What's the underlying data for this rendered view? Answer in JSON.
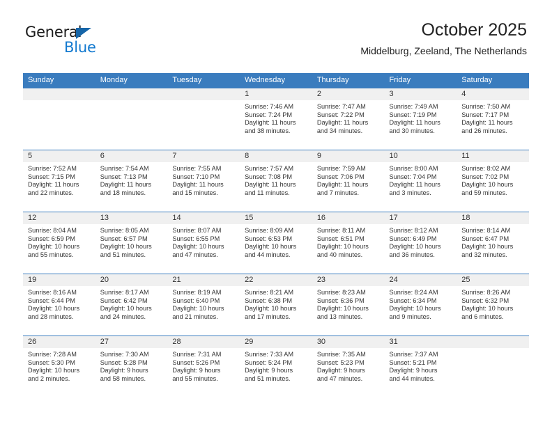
{
  "brand": {
    "name_top": "General",
    "name_bottom": "Blue",
    "triangle_color": "#1565a8",
    "blue_text_color": "#1279cf"
  },
  "header": {
    "title": "October 2025",
    "subtitle": "Middelburg, Zeeland, The Netherlands",
    "accent_color": "#3a7cbe",
    "daynum_band_color": "#f0f0f0"
  },
  "weekdays": [
    "Sunday",
    "Monday",
    "Tuesday",
    "Wednesday",
    "Thursday",
    "Friday",
    "Saturday"
  ],
  "labels": {
    "sunrise_prefix": "Sunrise:",
    "sunset_prefix": "Sunset:",
    "daylight_prefix": "Daylight:"
  },
  "weeks": [
    [
      {
        "day": "",
        "empty": true
      },
      {
        "day": "",
        "empty": true
      },
      {
        "day": "",
        "empty": true
      },
      {
        "day": "1",
        "sunrise": "Sunrise: 7:46 AM",
        "sunset": "Sunset: 7:24 PM",
        "daylight_1": "Daylight: 11 hours",
        "daylight_2": "and 38 minutes."
      },
      {
        "day": "2",
        "sunrise": "Sunrise: 7:47 AM",
        "sunset": "Sunset: 7:22 PM",
        "daylight_1": "Daylight: 11 hours",
        "daylight_2": "and 34 minutes."
      },
      {
        "day": "3",
        "sunrise": "Sunrise: 7:49 AM",
        "sunset": "Sunset: 7:19 PM",
        "daylight_1": "Daylight: 11 hours",
        "daylight_2": "and 30 minutes."
      },
      {
        "day": "4",
        "sunrise": "Sunrise: 7:50 AM",
        "sunset": "Sunset: 7:17 PM",
        "daylight_1": "Daylight: 11 hours",
        "daylight_2": "and 26 minutes."
      }
    ],
    [
      {
        "day": "5",
        "sunrise": "Sunrise: 7:52 AM",
        "sunset": "Sunset: 7:15 PM",
        "daylight_1": "Daylight: 11 hours",
        "daylight_2": "and 22 minutes."
      },
      {
        "day": "6",
        "sunrise": "Sunrise: 7:54 AM",
        "sunset": "Sunset: 7:13 PM",
        "daylight_1": "Daylight: 11 hours",
        "daylight_2": "and 18 minutes."
      },
      {
        "day": "7",
        "sunrise": "Sunrise: 7:55 AM",
        "sunset": "Sunset: 7:10 PM",
        "daylight_1": "Daylight: 11 hours",
        "daylight_2": "and 15 minutes."
      },
      {
        "day": "8",
        "sunrise": "Sunrise: 7:57 AM",
        "sunset": "Sunset: 7:08 PM",
        "daylight_1": "Daylight: 11 hours",
        "daylight_2": "and 11 minutes."
      },
      {
        "day": "9",
        "sunrise": "Sunrise: 7:59 AM",
        "sunset": "Sunset: 7:06 PM",
        "daylight_1": "Daylight: 11 hours",
        "daylight_2": "and 7 minutes."
      },
      {
        "day": "10",
        "sunrise": "Sunrise: 8:00 AM",
        "sunset": "Sunset: 7:04 PM",
        "daylight_1": "Daylight: 11 hours",
        "daylight_2": "and 3 minutes."
      },
      {
        "day": "11",
        "sunrise": "Sunrise: 8:02 AM",
        "sunset": "Sunset: 7:02 PM",
        "daylight_1": "Daylight: 10 hours",
        "daylight_2": "and 59 minutes."
      }
    ],
    [
      {
        "day": "12",
        "sunrise": "Sunrise: 8:04 AM",
        "sunset": "Sunset: 6:59 PM",
        "daylight_1": "Daylight: 10 hours",
        "daylight_2": "and 55 minutes."
      },
      {
        "day": "13",
        "sunrise": "Sunrise: 8:05 AM",
        "sunset": "Sunset: 6:57 PM",
        "daylight_1": "Daylight: 10 hours",
        "daylight_2": "and 51 minutes."
      },
      {
        "day": "14",
        "sunrise": "Sunrise: 8:07 AM",
        "sunset": "Sunset: 6:55 PM",
        "daylight_1": "Daylight: 10 hours",
        "daylight_2": "and 47 minutes."
      },
      {
        "day": "15",
        "sunrise": "Sunrise: 8:09 AM",
        "sunset": "Sunset: 6:53 PM",
        "daylight_1": "Daylight: 10 hours",
        "daylight_2": "and 44 minutes."
      },
      {
        "day": "16",
        "sunrise": "Sunrise: 8:11 AM",
        "sunset": "Sunset: 6:51 PM",
        "daylight_1": "Daylight: 10 hours",
        "daylight_2": "and 40 minutes."
      },
      {
        "day": "17",
        "sunrise": "Sunrise: 8:12 AM",
        "sunset": "Sunset: 6:49 PM",
        "daylight_1": "Daylight: 10 hours",
        "daylight_2": "and 36 minutes."
      },
      {
        "day": "18",
        "sunrise": "Sunrise: 8:14 AM",
        "sunset": "Sunset: 6:47 PM",
        "daylight_1": "Daylight: 10 hours",
        "daylight_2": "and 32 minutes."
      }
    ],
    [
      {
        "day": "19",
        "sunrise": "Sunrise: 8:16 AM",
        "sunset": "Sunset: 6:44 PM",
        "daylight_1": "Daylight: 10 hours",
        "daylight_2": "and 28 minutes."
      },
      {
        "day": "20",
        "sunrise": "Sunrise: 8:17 AM",
        "sunset": "Sunset: 6:42 PM",
        "daylight_1": "Daylight: 10 hours",
        "daylight_2": "and 24 minutes."
      },
      {
        "day": "21",
        "sunrise": "Sunrise: 8:19 AM",
        "sunset": "Sunset: 6:40 PM",
        "daylight_1": "Daylight: 10 hours",
        "daylight_2": "and 21 minutes."
      },
      {
        "day": "22",
        "sunrise": "Sunrise: 8:21 AM",
        "sunset": "Sunset: 6:38 PM",
        "daylight_1": "Daylight: 10 hours",
        "daylight_2": "and 17 minutes."
      },
      {
        "day": "23",
        "sunrise": "Sunrise: 8:23 AM",
        "sunset": "Sunset: 6:36 PM",
        "daylight_1": "Daylight: 10 hours",
        "daylight_2": "and 13 minutes."
      },
      {
        "day": "24",
        "sunrise": "Sunrise: 8:24 AM",
        "sunset": "Sunset: 6:34 PM",
        "daylight_1": "Daylight: 10 hours",
        "daylight_2": "and 9 minutes."
      },
      {
        "day": "25",
        "sunrise": "Sunrise: 8:26 AM",
        "sunset": "Sunset: 6:32 PM",
        "daylight_1": "Daylight: 10 hours",
        "daylight_2": "and 6 minutes."
      }
    ],
    [
      {
        "day": "26",
        "sunrise": "Sunrise: 7:28 AM",
        "sunset": "Sunset: 5:30 PM",
        "daylight_1": "Daylight: 10 hours",
        "daylight_2": "and 2 minutes."
      },
      {
        "day": "27",
        "sunrise": "Sunrise: 7:30 AM",
        "sunset": "Sunset: 5:28 PM",
        "daylight_1": "Daylight: 9 hours",
        "daylight_2": "and 58 minutes."
      },
      {
        "day": "28",
        "sunrise": "Sunrise: 7:31 AM",
        "sunset": "Sunset: 5:26 PM",
        "daylight_1": "Daylight: 9 hours",
        "daylight_2": "and 55 minutes."
      },
      {
        "day": "29",
        "sunrise": "Sunrise: 7:33 AM",
        "sunset": "Sunset: 5:24 PM",
        "daylight_1": "Daylight: 9 hours",
        "daylight_2": "and 51 minutes."
      },
      {
        "day": "30",
        "sunrise": "Sunrise: 7:35 AM",
        "sunset": "Sunset: 5:23 PM",
        "daylight_1": "Daylight: 9 hours",
        "daylight_2": "and 47 minutes."
      },
      {
        "day": "31",
        "sunrise": "Sunrise: 7:37 AM",
        "sunset": "Sunset: 5:21 PM",
        "daylight_1": "Daylight: 9 hours",
        "daylight_2": "and 44 minutes."
      },
      {
        "day": "",
        "empty": true
      }
    ]
  ]
}
